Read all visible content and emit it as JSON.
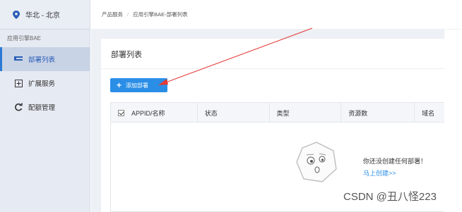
{
  "sidebar": {
    "region": "华北 - 北京",
    "section_label": "应用引擎BAE",
    "items": [
      {
        "label": "部署列表",
        "icon": "list-icon",
        "active": true
      },
      {
        "label": "扩展服务",
        "icon": "plus-square-icon",
        "active": false
      },
      {
        "label": "配额管理",
        "icon": "refresh-icon",
        "active": false
      }
    ]
  },
  "breadcrumb": {
    "root": "产品服务",
    "separator": "/",
    "current": "应用引擎BAE-部署列表"
  },
  "panel": {
    "title": "部署列表",
    "add_button": "添加部署"
  },
  "table": {
    "columns": [
      "APPID/名称",
      "状态",
      "类型",
      "资源数",
      "域名"
    ]
  },
  "empty_state": {
    "message": "你还没创建任何部署！",
    "link": "马上创建>>"
  },
  "watermark": "CSDN @丑八怪223",
  "colors": {
    "accent": "#2a8ee6",
    "arrow": "#e53935",
    "sidebar_bg": "#e6eaf2",
    "active_bg": "#c9d3e6"
  }
}
